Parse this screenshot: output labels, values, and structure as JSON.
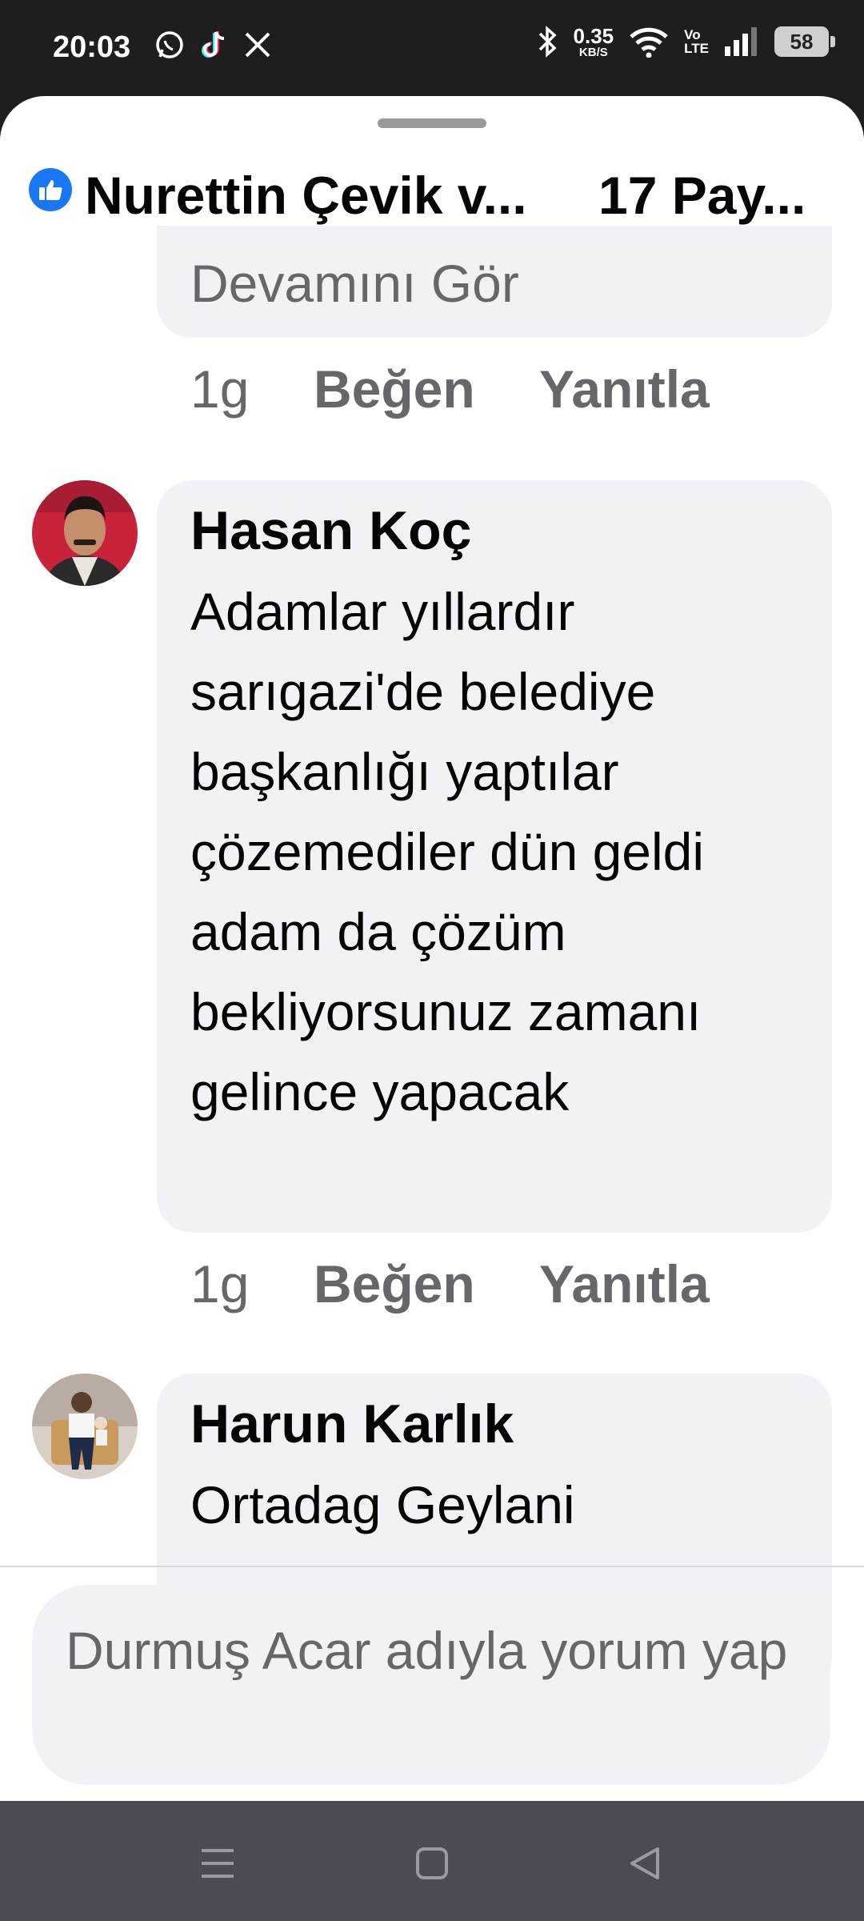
{
  "status_bar": {
    "time": "20:03",
    "app_icons": [
      "whatsapp-icon",
      "tiktok-icon",
      "x-icon"
    ],
    "net_speed": "0.35",
    "net_unit": "KB/S",
    "volte_top": "Vo",
    "volte_bottom": "LTE",
    "battery": "58"
  },
  "header": {
    "title": "Nurettin Çevik v...",
    "shares": "17 Pay..."
  },
  "comments": [
    {
      "see_more": "Devamını Gör",
      "time": "1g",
      "like": "Beğen",
      "reply": "Yanıtla"
    },
    {
      "author": "Hasan Koç",
      "text": "Adamlar yıllardır sarıgazi'de belediye başkanlığı yaptılar çözemediler  dün geldi adam da çözüm bekliyorsunuz zamanı gelince yapacak",
      "time": "1g",
      "like": "Beğen",
      "reply": "Yanıtla"
    },
    {
      "author": "Harun Karlık",
      "text": "Ortadag Geylani"
    }
  ],
  "composer": {
    "placeholder": "Durmuş Acar adıyla yorum yap"
  },
  "colors": {
    "accent": "#1877f2",
    "bubble": "#f0f2f5",
    "secondary_text": "#65676b"
  }
}
